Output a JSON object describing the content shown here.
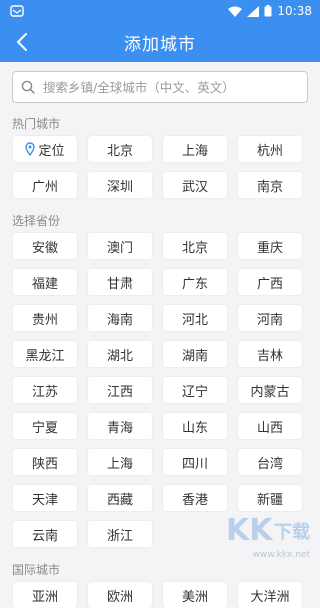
{
  "status_bar": {
    "time": "10:38"
  },
  "header": {
    "title": "添加城市"
  },
  "search": {
    "placeholder": "搜索乡镇/全球城市（中文、英文）"
  },
  "hot_cities": {
    "title": "热门城市",
    "locate_label": "定位",
    "items": [
      "北京",
      "上海",
      "杭州",
      "广州",
      "深圳",
      "武汉",
      "南京"
    ]
  },
  "provinces": {
    "title": "选择省份",
    "items": [
      "安徽",
      "澳门",
      "北京",
      "重庆",
      "福建",
      "甘肃",
      "广东",
      "广西",
      "贵州",
      "海南",
      "河北",
      "河南",
      "黑龙江",
      "湖北",
      "湖南",
      "吉林",
      "江苏",
      "江西",
      "辽宁",
      "内蒙古",
      "宁夏",
      "青海",
      "山东",
      "山西",
      "陕西",
      "上海",
      "四川",
      "台湾",
      "天津",
      "西藏",
      "香港",
      "新疆",
      "云南",
      "浙江"
    ]
  },
  "international": {
    "title": "国际城市",
    "items": [
      "亚洲",
      "欧洲",
      "美洲",
      "大洋洲"
    ]
  },
  "watermark": {
    "text": "www.kkx.net"
  },
  "colors": {
    "primary": "#3a8ff0",
    "background": "#f4f4f6",
    "chip": "#ffffff"
  }
}
